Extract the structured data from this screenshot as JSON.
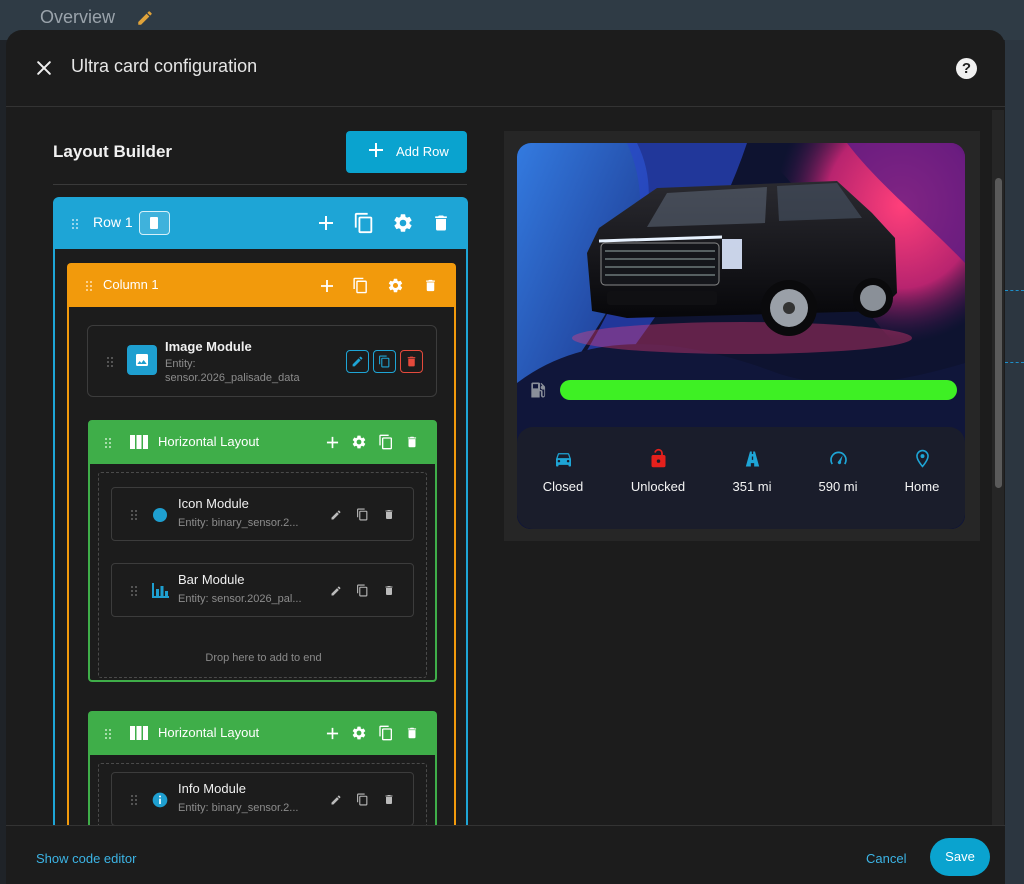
{
  "background": {
    "title": "Overview"
  },
  "dialog": {
    "title": "Ultra card configuration"
  },
  "layout_builder": {
    "title": "Layout Builder",
    "add_row_label": "Add Row",
    "row": {
      "label": "Row 1"
    },
    "column": {
      "label": "Column 1"
    },
    "image_module": {
      "title": "Image Module",
      "entity_line1": "Entity:",
      "entity_line2": "sensor.2026_palisade_data"
    },
    "horizontal_layouts": [
      {
        "label": "Horizontal Layout",
        "modules": [
          {
            "title": "Icon Module",
            "entity": "Entity: binary_sensor.2..."
          },
          {
            "title": "Bar Module",
            "entity": "Entity: sensor.2026_pal..."
          }
        ],
        "drop_text": "Drop here to add to end"
      },
      {
        "label": "Horizontal Layout",
        "modules": [
          {
            "title": "Info Module",
            "entity": "Entity: binary_sensor.2..."
          }
        ]
      }
    ]
  },
  "preview": {
    "fuel_level_percent": 100,
    "stats": [
      {
        "icon": "car-icon",
        "label": "Closed",
        "color": "#1ea5d6"
      },
      {
        "icon": "lock-open-icon",
        "label": "Unlocked",
        "color": "#e5201c"
      },
      {
        "icon": "road-icon",
        "label": "351 mi",
        "color": "#1ea5d6"
      },
      {
        "icon": "speedometer-icon",
        "label": "590 mi",
        "color": "#1ea5d6"
      },
      {
        "icon": "map-marker-icon",
        "label": "Home",
        "color": "#1ea5d6"
      }
    ]
  },
  "footer": {
    "show_code_label": "Show code editor",
    "cancel_label": "Cancel",
    "save_label": "Save"
  },
  "colors": {
    "row": "#1ea5d6",
    "column": "#f29a0c",
    "horizontal": "#3fae49",
    "primary": "#0aa3cf",
    "fuel": "#3ef024"
  }
}
